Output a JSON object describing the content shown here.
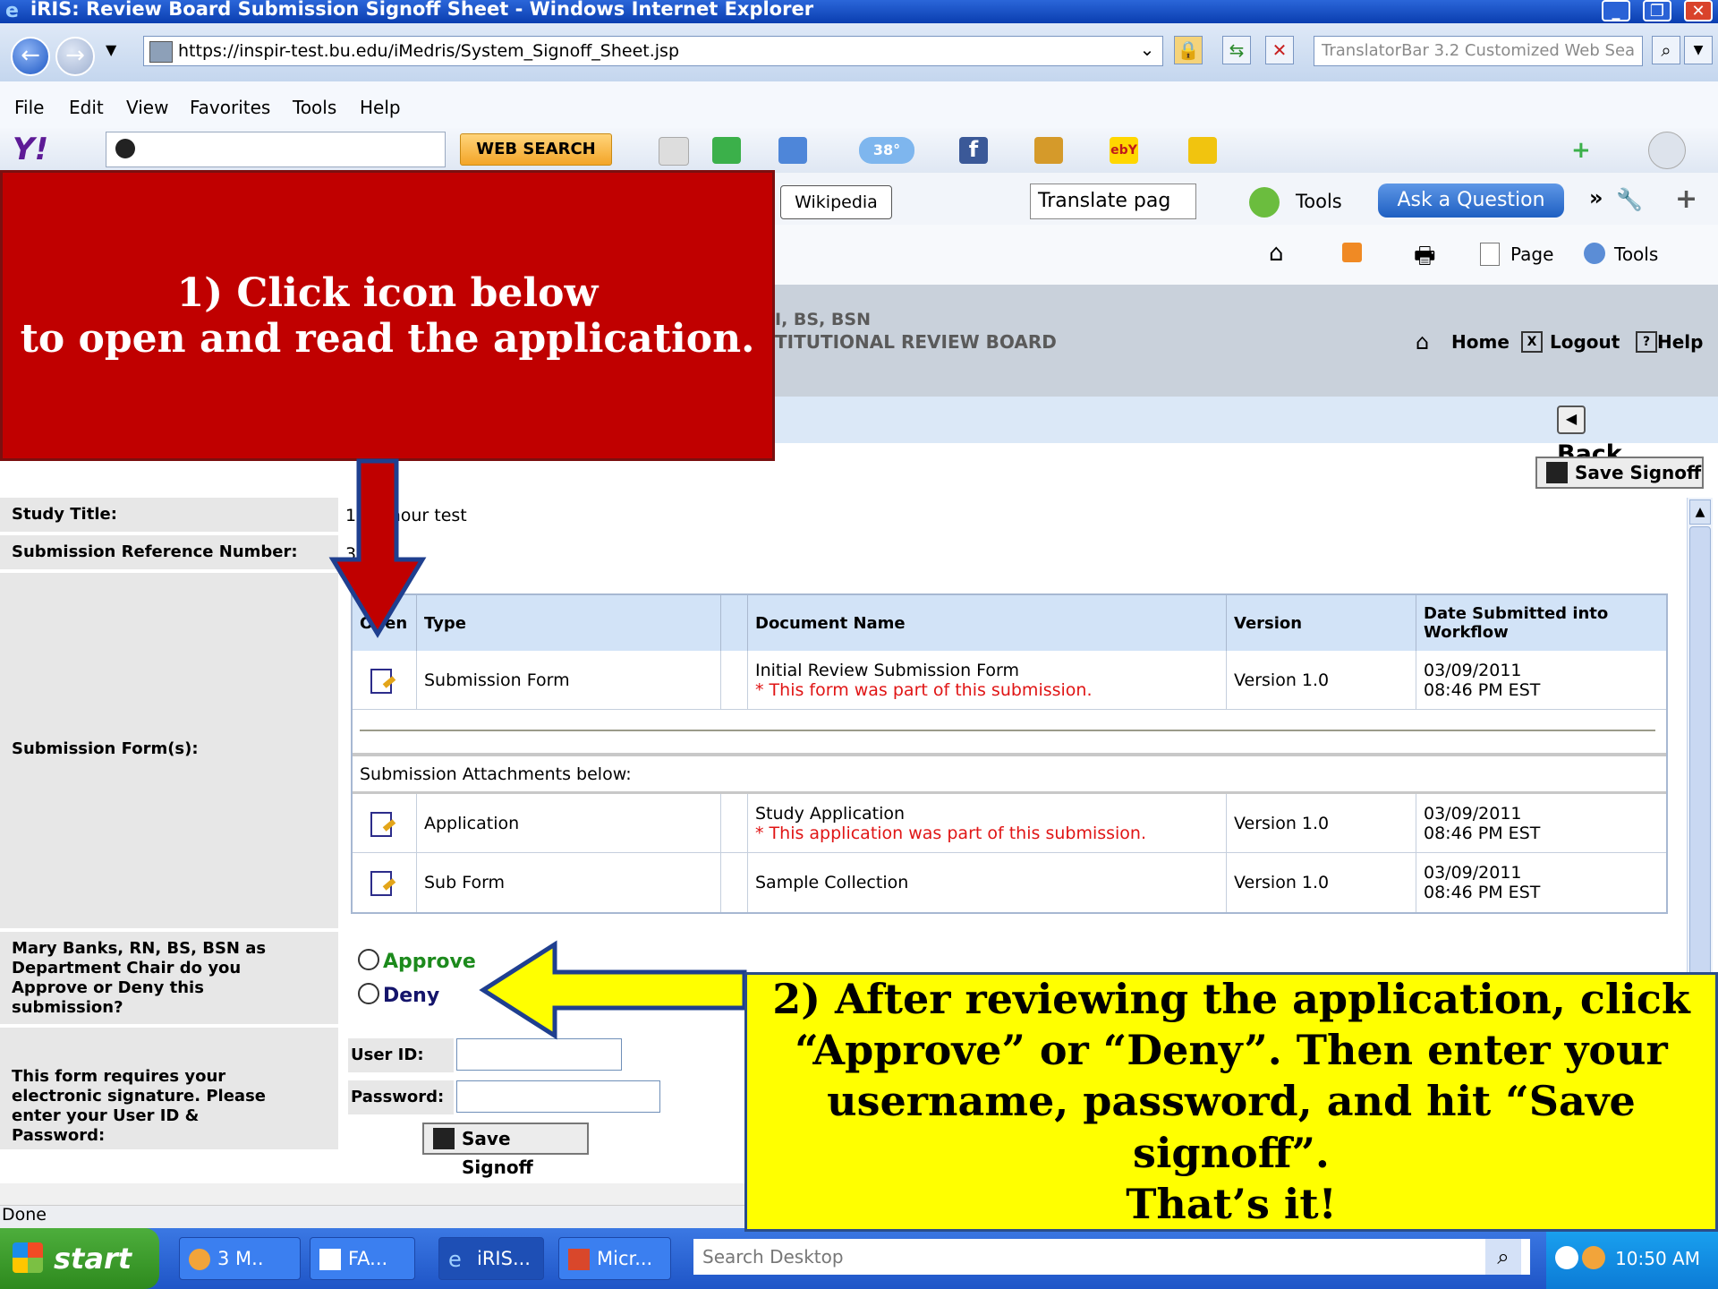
{
  "window": {
    "title": "iRIS: Review Board Submission Signoff Sheet - Windows Internet Explorer"
  },
  "address": {
    "url": "https://inspir-test.bu.edu/iMedris/System_Signoff_Sheet.jsp",
    "search_placeholder": "TranslatorBar 3.2 Customized Web Sea"
  },
  "menu": [
    "File",
    "Edit",
    "View",
    "Favorites",
    "Tools",
    "Help"
  ],
  "yahoo_toolbar": {
    "web_search": "WEB SEARCH",
    "weather_badge": "38°"
  },
  "toolbar2": {
    "wikipedia": "Wikipedia",
    "translate": "Translate pag",
    "tools": "Tools",
    "ask": "Ask a Question"
  },
  "commandbar": {
    "page": "Page",
    "tools": "Tools"
  },
  "app": {
    "user_line": "I, BS, BSN",
    "org_line": "TITUTIONAL REVIEW BOARD",
    "home": "Home",
    "logout": "Logout",
    "help": "Help",
    "back": "Back",
    "save_signoff": "Save Signoff"
  },
  "form": {
    "study_title_label": "Study Title:",
    "study_title_value": "11th hour test",
    "ref_label": "Submission Reference Number:",
    "ref_value": "31",
    "forms_label": "Submission Form(s):",
    "approve_label": "Mary Banks, RN, BS, BSN as Department Chair do you Approve or Deny this submission?",
    "approve_option": "Approve",
    "deny_option": "Deny",
    "signature_label": "This form requires your electronic signature. Please enter your User ID & Password:",
    "userid_label": "User ID:",
    "password_label": "Password:",
    "save_signoff": "Save Signoff"
  },
  "table": {
    "headers": [
      "Open",
      "Type",
      "Document Name",
      "Version",
      "Date Submitted into Workflow"
    ],
    "attachments_label": "Submission Attachments below:",
    "rows": [
      {
        "type": "Submission Form",
        "doc": "Initial Review Submission Form",
        "note": "* This form was part of this submission.",
        "version": "Version 1.0",
        "date": "03/09/2011",
        "time": "08:46 PM EST"
      },
      {
        "type": "Application",
        "doc": "Study Application",
        "note": "* This application was part of this submission.",
        "version": "Version 1.0",
        "date": "03/09/2011",
        "time": "08:46 PM EST"
      },
      {
        "type": "Sub Form",
        "doc": "Sample Collection",
        "note": "",
        "version": "Version 1.0",
        "date": "03/09/2011",
        "time": "08:46 PM EST"
      }
    ]
  },
  "status": {
    "text": "Done"
  },
  "taskbar": {
    "start": "start",
    "tasks": [
      "3 M..",
      "FA...",
      "iRIS...",
      "Micr..."
    ],
    "search_placeholder": "Search Desktop",
    "clock": "10:50 AM"
  },
  "callouts": {
    "c1_line1": "1)  Click icon below",
    "c1_line2": "to open and read the application.",
    "c2_line1": "2)  After reviewing the application, click",
    "c2_line2": "“Approve” or “Deny”.  Then enter your",
    "c2_line3": "username, password, and hit “Save signoff”.",
    "c2_line4": "That’s it!"
  },
  "colors": {
    "callout1_bg": "#c00000",
    "callout2_bg": "#ffff00",
    "arrow_blue": "#1f3f8f"
  }
}
